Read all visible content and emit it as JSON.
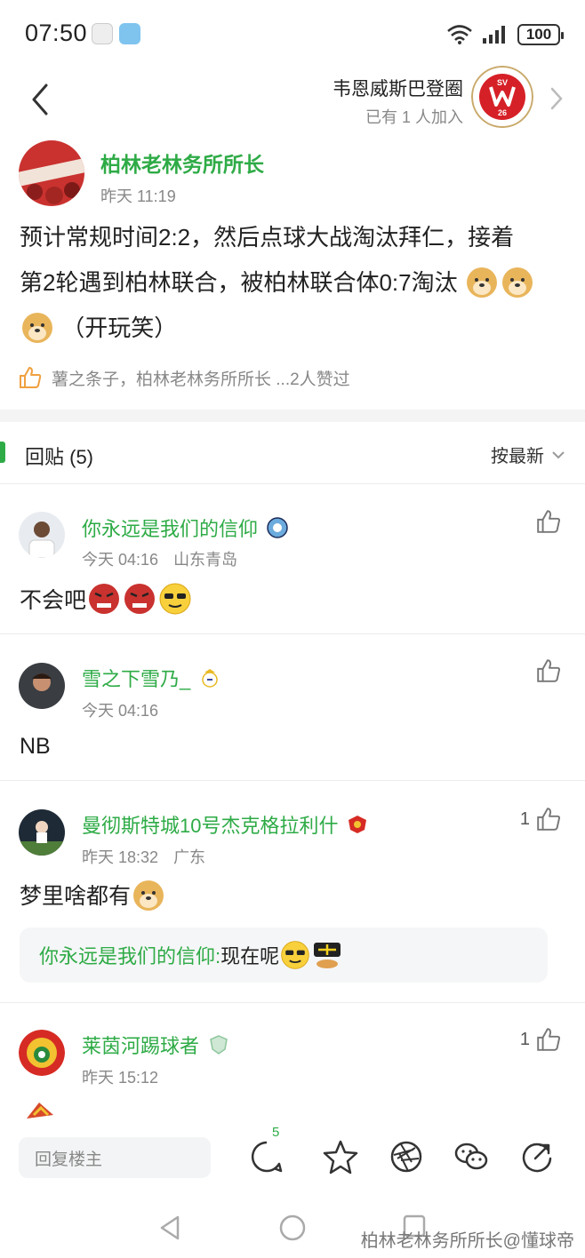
{
  "status_bar": {
    "time": "07:50",
    "battery": "100",
    "network": "6"
  },
  "circle": {
    "name": "韦恩威斯巴登圈",
    "members": "已有 1 人加入",
    "logo_text": "SV 26"
  },
  "post": {
    "author": "柏林老林务所所长",
    "time": "昨天 11:19",
    "line1": "预计常规时间2:2，然后点球大战淘汰拜仁，接着",
    "line2": "第2轮遇到柏林联合，被柏林联合体0:7淘汰",
    "line3": "（开玩笑）",
    "likers": "薯之条子，柏林老林务所所长 ...2人赞过"
  },
  "replies": {
    "title": "回贴 (5)",
    "sort": "按最新"
  },
  "comments": [
    {
      "name": "你永远是我们的信仰",
      "time": "今天 04:16",
      "location": "山东青岛",
      "text": "不会吧",
      "likes": ""
    },
    {
      "name": "雪之下雪乃_",
      "time": "今天 04:16",
      "location": "",
      "text": "NB",
      "likes": ""
    },
    {
      "name": "曼彻斯特城10号杰克格拉利什",
      "time": "昨天 18:32",
      "location": "广东",
      "text": "梦里啥都有",
      "likes": "1",
      "sub_reply": {
        "name": "你永远是我们的信仰:",
        "text": " 现在呢"
      }
    },
    {
      "name": "莱茵河踢球者",
      "time": "昨天 15:12",
      "location": "",
      "text": "",
      "likes": "1"
    }
  ],
  "bottom_bar": {
    "reply_placeholder": "回复楼主",
    "comment_count": "5"
  },
  "watermark": "柏林老林务所所长@懂球帝",
  "colors": {
    "accent_green": "#2eab46",
    "text_gray": "#888888"
  },
  "icons": [
    "back-chevron-icon",
    "forward-chevron-icon",
    "thumbs-up-icon",
    "comment-icon",
    "star-icon",
    "aperture-icon",
    "wechat-icon",
    "share-icon"
  ]
}
